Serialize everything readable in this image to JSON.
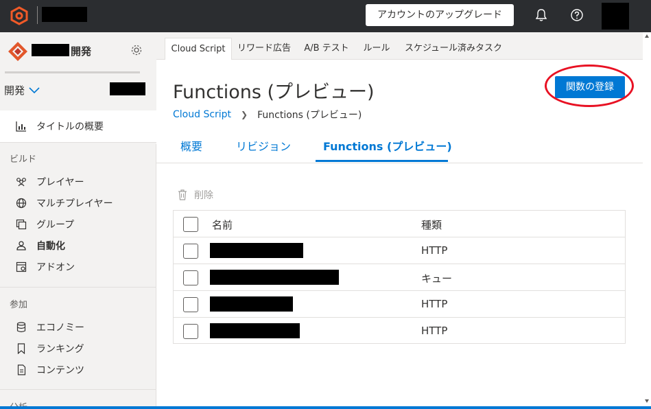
{
  "topbar": {
    "logo_icon": "playfab-logo-icon",
    "upgrade_label": "アカウントのアップグレード",
    "bell_icon": "bell-icon",
    "help_icon": "help-icon"
  },
  "sidebar": {
    "studio_suffix": "開発",
    "environment": "開発",
    "overview_label": "タイトルの概要",
    "sections": [
      {
        "label": "ビルド",
        "items": [
          {
            "label": "プレイヤー",
            "icon": "players-icon"
          },
          {
            "label": "マルチプレイヤー",
            "icon": "globe-icon"
          },
          {
            "label": "グループ",
            "icon": "groups-icon"
          },
          {
            "label": "自動化",
            "icon": "automation-icon",
            "active": true
          },
          {
            "label": "アドオン",
            "icon": "addons-icon"
          }
        ]
      },
      {
        "label": "参加",
        "items": [
          {
            "label": "エコノミー",
            "icon": "economy-icon"
          },
          {
            "label": "ランキング",
            "icon": "bookmark-icon"
          },
          {
            "label": "コンテンツ",
            "icon": "document-icon"
          }
        ]
      },
      {
        "label": "分析",
        "items": []
      }
    ]
  },
  "tabs": [
    "Cloud Script",
    "リワード広告",
    "A/B テスト",
    "ルール",
    "スケジュール済みタスク"
  ],
  "main": {
    "title": "Functions (プレビュー)",
    "register_label": "関数の登録",
    "breadcrumb": {
      "link": "Cloud Script",
      "current": "Functions (プレビュー)"
    },
    "subtabs": [
      "概要",
      "リビジョン",
      "Functions (プレビュー)"
    ],
    "delete_label": "削除",
    "table": {
      "headers": {
        "name": "名前",
        "type": "種類"
      },
      "rows": [
        {
          "type": "HTTP"
        },
        {
          "type": "キュー"
        },
        {
          "type": "HTTP"
        },
        {
          "type": "HTTP"
        }
      ]
    }
  },
  "colors": {
    "accent": "#0078d4",
    "topbar": "#2b2d30",
    "highlight": "#e81123",
    "brand": "#e2572b"
  }
}
